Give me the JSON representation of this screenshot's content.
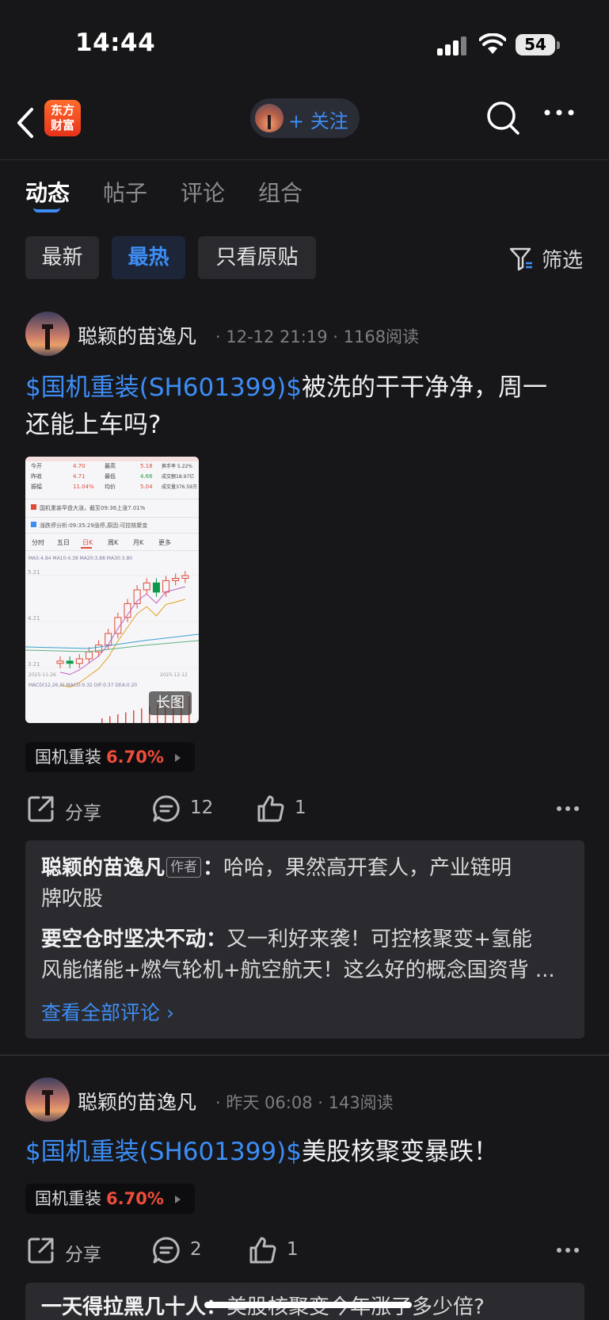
{
  "status_bar": {
    "time": "14:44",
    "battery": "54"
  },
  "nav": {
    "logo_line1": "东方",
    "logo_line2": "财富",
    "follow_label": "+ 关注"
  },
  "tabs": [
    {
      "label": "动态",
      "active": true
    },
    {
      "label": "帖子",
      "active": false
    },
    {
      "label": "评论",
      "active": false
    },
    {
      "label": "组合",
      "active": false
    }
  ],
  "filters": {
    "chips": [
      {
        "label": "最新",
        "active": false
      },
      {
        "label": "最热",
        "active": true
      },
      {
        "label": "只看原贴",
        "active": false
      }
    ],
    "filter_label": "筛选"
  },
  "posts": [
    {
      "author": "聪颖的苗逸凡",
      "date": "12-12 21:19",
      "reads": "1168阅读",
      "stock_tag": "$国机重装(SH601399)$",
      "text_line1_rest": "被洗的干干净净，周一",
      "text_line2": "还能上车吗?",
      "image_badge": "长图",
      "stock_chip": {
        "name": "国机重装",
        "change": "6.70%"
      },
      "share_label": "分享",
      "comments": "12",
      "likes": "1",
      "comment_preview": [
        {
          "author": "聪颖的苗逸凡",
          "tag": "作者",
          "line1": "哈哈，果然高开套人，产业链明",
          "line2": "牌吹股"
        },
        {
          "author": "要空仓时坚决不动",
          "line1": "又一利好来袭！可控核聚变+氢能",
          "line2": "风能储能+燃气轮机+航空航天！这么好的概念国资背 ..."
        }
      ],
      "see_all_label": "查看全部评论 ›",
      "thumb": {
        "rows": [
          [
            "今开",
            "4.70",
            "最高",
            "5.18",
            "换手率 5.22%"
          ],
          [
            "昨收",
            "4.71",
            "最低",
            "4.66",
            "成交额18.97亿"
          ],
          [
            "振幅",
            "11.04%",
            "均价",
            "5.04",
            "成交量376.59万"
          ]
        ],
        "notice1": "国机重装早盘大涨，截至09:36上涨7.01%",
        "notice2": "涨跌停分析:09:35:29涨停,原因:可控核聚变",
        "periods": [
          "分时",
          "五日",
          "日K",
          "周K",
          "月K",
          "更多"
        ],
        "ma_line": "MA5:4.84  MA10:4.38  MA20:3.88  MA30:3.80",
        "price_top": "5.21",
        "price_mid": "4.21",
        "price_low": "3.21",
        "date_left": "2025-11-26",
        "date_right": "2025-12-12",
        "macd_line": "MACD(12,26,9)  MACD:0.32  DIF:0.37  DEA:0.20",
        "kline_closes": [
          3.35,
          3.3,
          3.4,
          3.55,
          3.7,
          3.95,
          4.3,
          4.6,
          4.9,
          5.05,
          4.85,
          5.1,
          5.15,
          5.21
        ]
      }
    },
    {
      "author": "聪颖的苗逸凡",
      "date": "昨天 06:08",
      "reads": "143阅读",
      "stock_tag": "$国机重装(SH601399)$",
      "text_line1_rest": "美股核聚变暴跌！",
      "stock_chip": {
        "name": "国机重装",
        "change": "6.70%"
      },
      "share_label": "分享",
      "comments": "2",
      "likes": "1",
      "comment_preview": [
        {
          "author": "一天得拉黑几十人",
          "line1": "美股核聚变今年涨了多少倍?"
        }
      ]
    }
  ],
  "colors": {
    "accent": "#3d8df5",
    "up_red": "#f04d3a",
    "bg": "#17171a",
    "card": "#2b2b2f"
  }
}
